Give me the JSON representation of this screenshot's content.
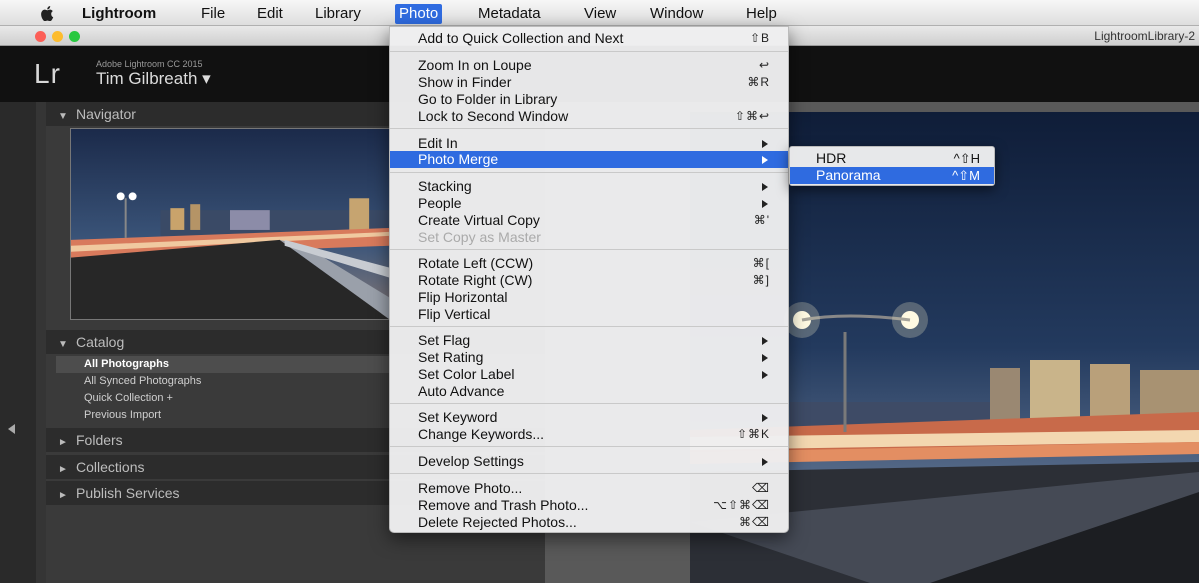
{
  "menubar": {
    "items": [
      "Lightroom",
      "File",
      "Edit",
      "Library",
      "Photo",
      "Metadata",
      "View",
      "Window",
      "Help"
    ],
    "active": "Photo"
  },
  "window": {
    "title": "LightroomLibrary-2"
  },
  "identity": {
    "logo": "Lr",
    "product": "Adobe Lightroom CC 2015",
    "user": "Tim Gilbreath ▾"
  },
  "left_panel": {
    "navigator": "Navigator",
    "catalog": "Catalog",
    "catalog_items": [
      "All Photographs",
      "All Synced Photographs",
      "Quick Collection +",
      "Previous Import"
    ],
    "folders": "Folders",
    "collections": "Collections",
    "publish_services": "Publish Services"
  },
  "photo_menu": {
    "items": [
      {
        "label": "Add to Quick Collection and Next",
        "shortcut": "⇧B"
      },
      {
        "label": "Zoom In on Loupe",
        "shortcut": "↩"
      },
      {
        "label": "Show in Finder",
        "shortcut": "⌘R"
      },
      {
        "label": "Go to Folder in Library",
        "shortcut": ""
      },
      {
        "label": "Lock to Second Window",
        "shortcut": "⇧⌘↩"
      },
      {
        "label": "Edit In",
        "shortcut": ""
      },
      {
        "label": "Photo Merge",
        "shortcut": ""
      },
      {
        "label": "Stacking",
        "shortcut": ""
      },
      {
        "label": "People",
        "shortcut": ""
      },
      {
        "label": "Create Virtual Copy",
        "shortcut": "⌘'"
      },
      {
        "label": "Set Copy as Master",
        "shortcut": ""
      },
      {
        "label": "Rotate Left (CCW)",
        "shortcut": "⌘["
      },
      {
        "label": "Rotate Right (CW)",
        "shortcut": "⌘]"
      },
      {
        "label": "Flip Horizontal",
        "shortcut": ""
      },
      {
        "label": "Flip Vertical",
        "shortcut": ""
      },
      {
        "label": "Set Flag",
        "shortcut": ""
      },
      {
        "label": "Set Rating",
        "shortcut": ""
      },
      {
        "label": "Set Color Label",
        "shortcut": ""
      },
      {
        "label": "Auto Advance",
        "shortcut": ""
      },
      {
        "label": "Set Keyword",
        "shortcut": ""
      },
      {
        "label": "Change Keywords...",
        "shortcut": "⇧⌘K"
      },
      {
        "label": "Develop Settings",
        "shortcut": ""
      },
      {
        "label": "Remove Photo...",
        "shortcut": "⌫"
      },
      {
        "label": "Remove and Trash Photo...",
        "shortcut": "⌥⇧⌘⌫"
      },
      {
        "label": "Delete Rejected Photos...",
        "shortcut": "⌘⌫"
      }
    ]
  },
  "photo_merge_submenu": {
    "items": [
      {
        "label": "HDR",
        "shortcut": "^⇧H"
      },
      {
        "label": "Panorama",
        "shortcut": "^⇧M"
      }
    ]
  },
  "colors": {
    "highlight": "#2f6be0",
    "panel": "#3a3a3a",
    "menu_bg": "#eeeef0"
  }
}
